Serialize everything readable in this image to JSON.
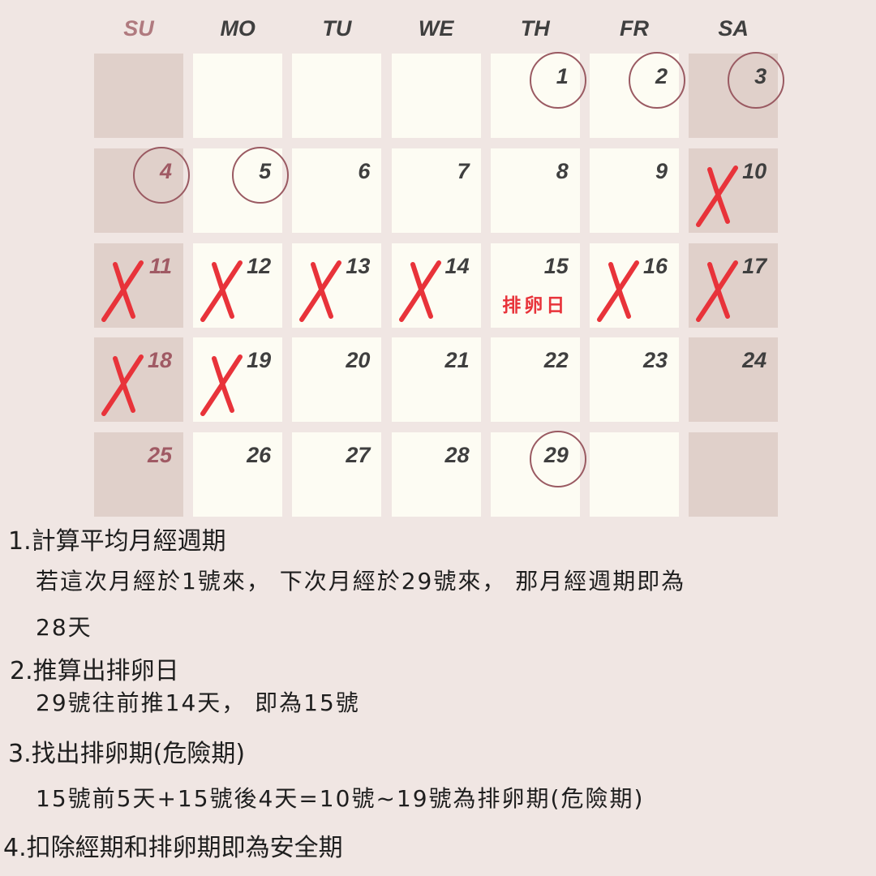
{
  "calendar": {
    "weekdays": [
      "SU",
      "MO",
      "TU",
      "WE",
      "TH",
      "FR",
      "SA"
    ],
    "weeks": [
      [
        {
          "d": ""
        },
        {
          "d": ""
        },
        {
          "d": ""
        },
        {
          "d": ""
        },
        {
          "d": "1"
        },
        {
          "d": "2"
        },
        {
          "d": "3"
        }
      ],
      [
        {
          "d": "4"
        },
        {
          "d": "5"
        },
        {
          "d": "6"
        },
        {
          "d": "7"
        },
        {
          "d": "8"
        },
        {
          "d": "9"
        },
        {
          "d": "10"
        }
      ],
      [
        {
          "d": "11"
        },
        {
          "d": "12"
        },
        {
          "d": "13"
        },
        {
          "d": "14"
        },
        {
          "d": "15",
          "label": "排卵日"
        },
        {
          "d": "16"
        },
        {
          "d": "17"
        }
      ],
      [
        {
          "d": "18"
        },
        {
          "d": "19"
        },
        {
          "d": "20"
        },
        {
          "d": "21"
        },
        {
          "d": "22"
        },
        {
          "d": "23"
        },
        {
          "d": "24"
        }
      ],
      [
        {
          "d": "25"
        },
        {
          "d": "26"
        },
        {
          "d": "27"
        },
        {
          "d": "28"
        },
        {
          "d": "29"
        },
        {
          "d": ""
        },
        {
          "d": ""
        }
      ]
    ],
    "circled_days": [
      "1",
      "2",
      "3",
      "4",
      "5",
      "29"
    ],
    "crossed_days": [
      "10",
      "11",
      "12",
      "13",
      "14",
      "16",
      "17",
      "18",
      "19"
    ],
    "colors": {
      "background": "#f0e6e3",
      "cell": "#fdfcf3",
      "weekend_cell": "#e0d0ca",
      "circle": "#9a5a62",
      "cross": "#e8333a",
      "sunday_text": "#a05a64"
    }
  },
  "notes": {
    "step1_title": "1.計算平均月經週期",
    "step1_body_a": "若這次月經於1號來，  下次月經於29號來，  那月經週期即為",
    "step1_body_b": "28天",
    "step2_title": "2.推算出排卵日",
    "step2_body": "29號往前推14天，  即為15號",
    "step3_title": "3.找出排卵期(危險期)",
    "step3_body": "15號前5天+15號後4天=10號~19號為排卵期(危險期)",
    "step4_title": "4.扣除經期和排卵期即為安全期"
  }
}
